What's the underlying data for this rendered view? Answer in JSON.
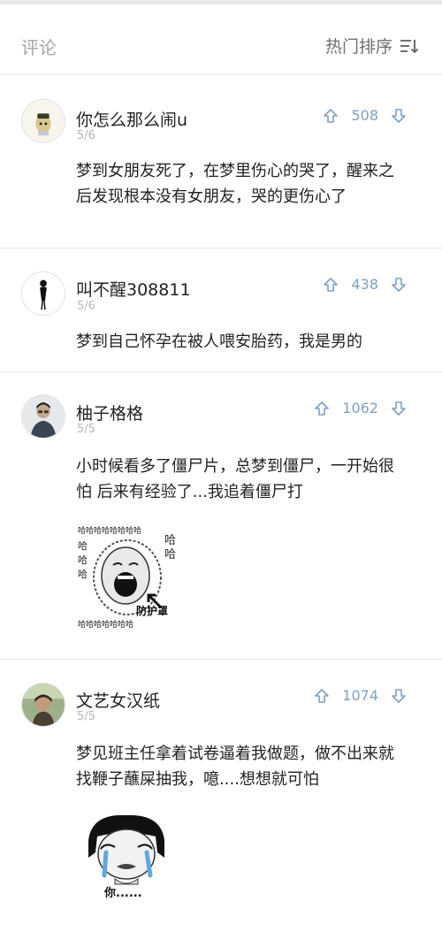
{
  "header": {
    "title": "评论",
    "sort_label": "热门排序",
    "sort_icon": "sort-lines-icon"
  },
  "colors": {
    "vote_blue": "#7fa0c4",
    "muted_text": "#b6b6b6",
    "divider": "#e8e8e8"
  },
  "comments": [
    {
      "username": "你怎么那么闹u",
      "date": "5/6",
      "votes": "508",
      "text": "梦到女朋友死了，在梦里伤心的哭了，醒来之后发现根本没有女朋友，哭的更伤心了"
    },
    {
      "username": "叫不醒308811",
      "date": "5/6",
      "votes": "438",
      "text": "梦到自己怀孕在被人喂安胎药，我是男的"
    },
    {
      "username": "柚子格格",
      "date": "5/5",
      "votes": "1062",
      "text": "小时候看多了僵尸片，总梦到僵尸，一开始很怕 后来有经验了...我追着僵尸打",
      "meme": {
        "ha_top": "哈哈哈哈哈哈哈哈",
        "ha_side": "哈",
        "ha_bottom": "哈哈哈哈哈哈哈",
        "caption": "防护罩"
      }
    },
    {
      "username": "文艺女汉纸",
      "date": "5/5",
      "votes": "1074",
      "text": "梦见班主任拿着试卷逼着我做题，做不出来就找鞭子蘸屎抽我，噫....想想就可怕",
      "meme": {
        "caption": "你......"
      }
    }
  ]
}
